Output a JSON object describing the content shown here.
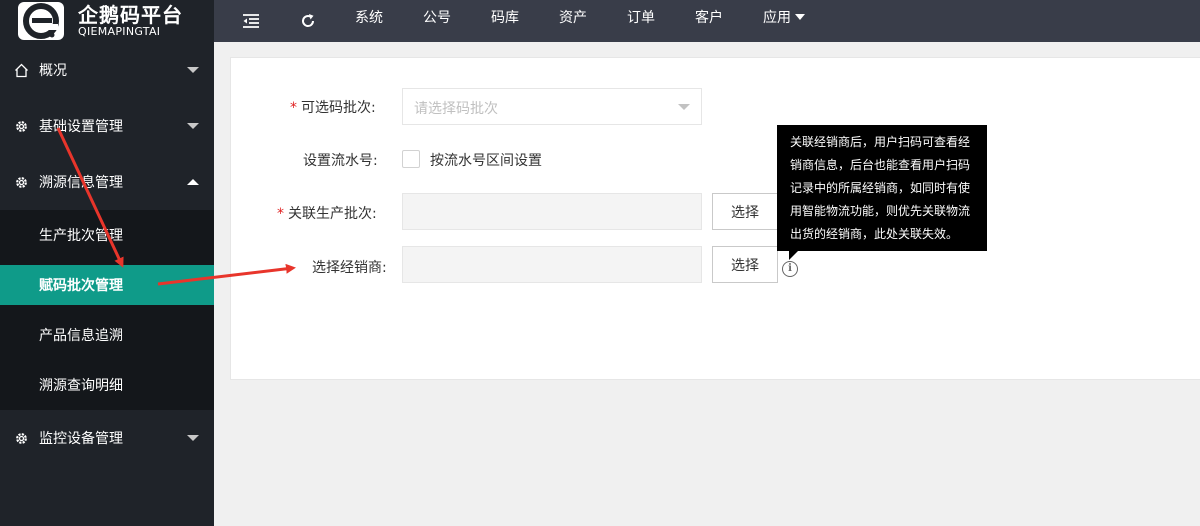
{
  "logo": {
    "name_cn": "企鹅码平台",
    "name_en": "QIEMAPINGTAI"
  },
  "topbar": {
    "menu_toggle_icon": "indent-icon",
    "refresh_icon": "refresh-icon",
    "nav": [
      "系统",
      "公号",
      "码库",
      "资产",
      "订单",
      "客户",
      "应用"
    ]
  },
  "sidebar": {
    "items": [
      {
        "label": "概况",
        "icon": "home-icon",
        "expanded": false
      },
      {
        "label": "基础设置管理",
        "icon": "gear-icon",
        "expanded": false
      },
      {
        "label": "溯源信息管理",
        "icon": "gear-icon",
        "expanded": true
      },
      {
        "label": "监控设备管理",
        "icon": "gear-icon",
        "expanded": false
      }
    ],
    "submenu": [
      {
        "label": "生产批次管理",
        "active": false
      },
      {
        "label": "赋码批次管理",
        "active": true
      },
      {
        "label": "产品信息追溯",
        "active": false
      },
      {
        "label": "溯源查询明细",
        "active": false
      }
    ],
    "active_color": "#0f9b89"
  },
  "form": {
    "code_batch": {
      "required_mark": "*",
      "label": "可选码批次:",
      "placeholder": "请选择码批次"
    },
    "serial": {
      "label": "设置流水号:",
      "checkbox_label": "按流水号区间设置",
      "checked": false
    },
    "production_batch": {
      "required_mark": "*",
      "label": "关联生产批次:",
      "button": "选择"
    },
    "dealer": {
      "label": "选择经销商:",
      "button": "选择"
    }
  },
  "tooltip": {
    "text": "关联经销商后，用户扫码可查看经销商信息，后台也能查看用户扫码记录中的所属经销商，如同时有使用智能物流功能，则优先关联物流出货的经销商，此处关联失效。"
  },
  "annotation_color": "#e8352b"
}
